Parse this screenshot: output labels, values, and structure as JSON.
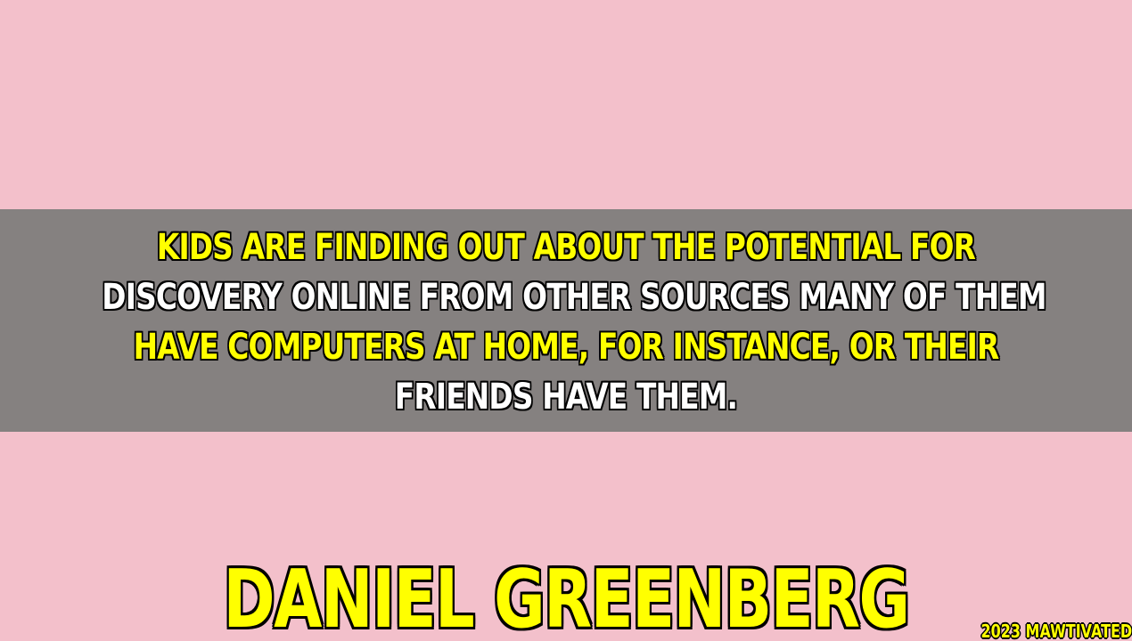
{
  "colors": {
    "background": "#f3c0cb",
    "band": "#858180",
    "yellow": "#ffff00",
    "white": "#ffffff",
    "outline": "#000000"
  },
  "quote": {
    "lines": [
      {
        "text": "KIDS ARE FINDING OUT ABOUT THE POTENTIAL FOR",
        "color": "yellow"
      },
      {
        "text": "DISCOVERY ONLINE FROM OTHER SOURCES MANY OF THEM",
        "color": "white"
      },
      {
        "text": "HAVE COMPUTERS AT HOME, FOR INSTANCE, OR THEIR",
        "color": "yellow"
      },
      {
        "text": "FRIENDS HAVE THEM.",
        "color": "white"
      }
    ]
  },
  "author": {
    "name": "DANIEL GREENBERG"
  },
  "watermark": {
    "text": "2023 MAWTIVATED"
  }
}
